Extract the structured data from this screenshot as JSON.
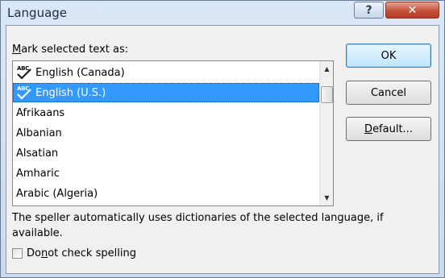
{
  "window": {
    "title": "Language",
    "help_label": "?",
    "close_label": "✕"
  },
  "prompt": {
    "prefix": "M",
    "rest": "ark selected text as:"
  },
  "list": {
    "items": [
      {
        "label": "English (Canada)",
        "spell_icon": true,
        "selected": false
      },
      {
        "label": "English (U.S.)",
        "spell_icon": true,
        "selected": true
      },
      {
        "label": "Afrikaans",
        "spell_icon": false,
        "selected": false
      },
      {
        "label": "Albanian",
        "spell_icon": false,
        "selected": false
      },
      {
        "label": "Alsatian",
        "spell_icon": false,
        "selected": false
      },
      {
        "label": "Amharic",
        "spell_icon": false,
        "selected": false
      },
      {
        "label": "Arabic (Algeria)",
        "spell_icon": false,
        "selected": false
      }
    ],
    "icon_text": "ABC"
  },
  "buttons": {
    "ok": "OK",
    "cancel": "Cancel",
    "default_prefix": "D",
    "default_rest": "efault..."
  },
  "description": "The speller automatically uses dictionaries of the selected language, if available.",
  "checkbox": {
    "prefix": "Do ",
    "underlined": "n",
    "rest": "ot check spelling",
    "checked": false
  },
  "colors": {
    "selection": "#3399ff",
    "close_button": "#c7503a",
    "dialog_bg": "#f0f0f0"
  }
}
